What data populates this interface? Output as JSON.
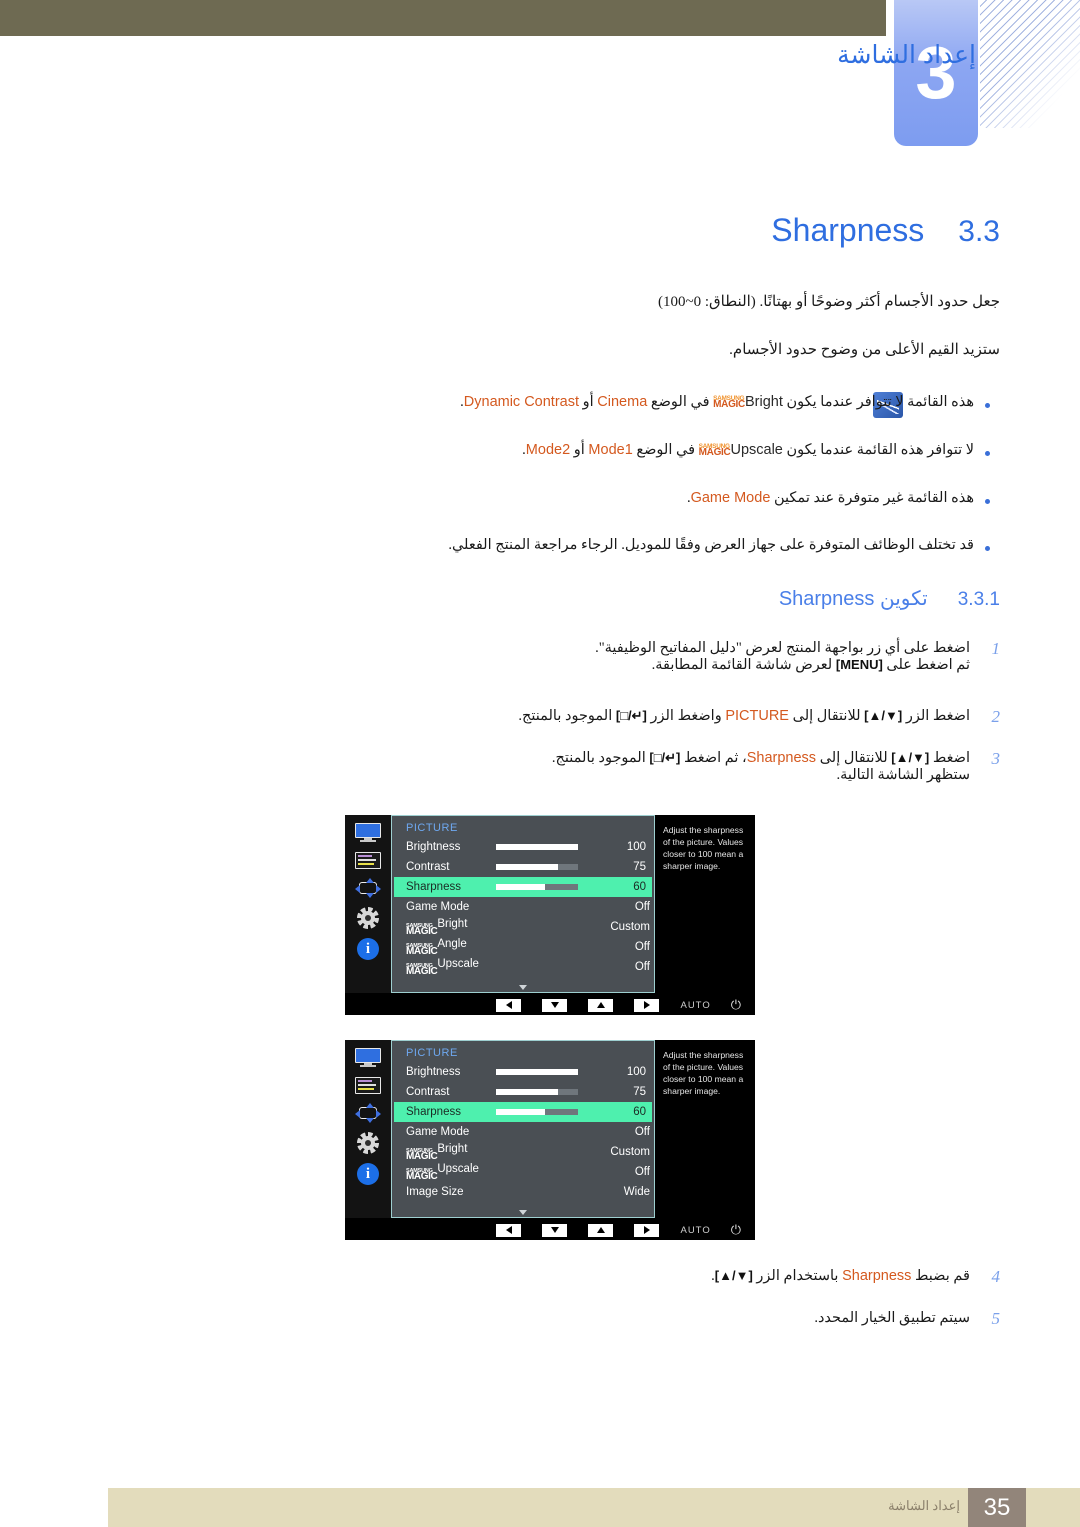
{
  "header": {
    "chapter_number": "3",
    "chapter_title": "إعداد الشاشة"
  },
  "section": {
    "number": "3.3",
    "title": "Sharpness"
  },
  "intro": {
    "line1": "جعل حدود الأجسام أكثر وضوحًا أو بهتانًا. (النطاق: 0~100)",
    "line2": "ستزيد القيم الأعلى من وضوح حدود الأجسام."
  },
  "notes": [
    {
      "pre": "هذه القائمة لا تتوافر عندما يكون ",
      "magic_word": "Bright",
      "mid": " في الوضع ",
      "em1": "Cinema",
      "mid2": " أو ",
      "em2": "Dynamic Contrast",
      "post": "."
    },
    {
      "pre": "لا تتوافر هذه القائمة عندما يكون ",
      "magic_word": "Upscale",
      "mid": " في الوضع ",
      "em1": "Mode1",
      "mid2": " أو ",
      "em2": "Mode2",
      "post": "."
    },
    {
      "pre": "هذه القائمة غير متوفرة عند تمكين ",
      "em1": "Game Mode",
      "post": "."
    },
    {
      "plain": "قد تختلف الوظائف المتوفرة على جهاز العرض وفقًا للموديل. الرجاء مراجعة المنتج الفعلي."
    }
  ],
  "subsection": {
    "number": "3.3.1",
    "title_ar": "تكوين",
    "title_en": "Sharpness"
  },
  "steps": [
    {
      "n": "1",
      "line1": "اضغط على أي زر بواجهة المنتج لعرض \"دليل المفاتيح الوظيفية\".",
      "line2_pre": "ثم اضغط على ",
      "line2_key": "[MENU]",
      "line2_post": " لعرض شاشة القائمة المطابقة."
    },
    {
      "n": "2",
      "pre": "اضغط الزر ",
      "key1": "[▲/▼]",
      "mid": " للانتقال إلى ",
      "em": "PICTURE",
      "mid2": " واضغط الزر ",
      "key2": "[□/↵]",
      "post": " الموجود بالمنتج."
    },
    {
      "n": "3",
      "pre": "اضغط ",
      "key1": "[▲/▼]",
      "mid": " للانتقال إلى ",
      "em": "Sharpness",
      "mid2": "، ثم اضغط ",
      "key2": "[□/↵]",
      "post": " الموجود بالمنتج.",
      "line2": "ستظهر الشاشة التالية."
    },
    {
      "n": "4",
      "pre": "قم بضبط ",
      "em": "Sharpness",
      "mid": " باستخدام الزر ",
      "key1": "[▲/▼]",
      "post": "."
    },
    {
      "n": "5",
      "plain": "سيتم تطبيق الخيار المحدد."
    }
  ],
  "osd": {
    "heading": "PICTURE",
    "help_text": "Adjust the sharpness of the picture. Values closer to 100 mean a sharper image.",
    "bottom": {
      "auto_label": "AUTO",
      "power_icon": "⏻",
      "left_icon": "left-arrow",
      "down_icon": "down-arrow",
      "up_icon": "up-arrow",
      "right_icon": "right-arrow"
    },
    "rail_icons": [
      "monitor-icon",
      "color-list-icon",
      "position-arrows-icon",
      "gear-icon",
      "info-icon"
    ],
    "menu1": [
      {
        "label": "Brightness",
        "value": "100",
        "bar": 100,
        "selected": false
      },
      {
        "label": "Contrast",
        "value": "75",
        "bar": 75,
        "selected": false
      },
      {
        "label": "Sharpness",
        "value": "60",
        "bar": 60,
        "selected": true
      },
      {
        "label": "Game Mode",
        "value": "Off",
        "bar": null,
        "selected": false
      },
      {
        "magic": "Bright",
        "label": "",
        "value": "Custom",
        "bar": null,
        "selected": false
      },
      {
        "magic": "Angle",
        "label": "",
        "value": "Off",
        "bar": null,
        "selected": false
      },
      {
        "magic": "Upscale",
        "label": "",
        "value": "Off",
        "bar": null,
        "selected": false
      }
    ],
    "menu2": [
      {
        "label": "Brightness",
        "value": "100",
        "bar": 100,
        "selected": false
      },
      {
        "label": "Contrast",
        "value": "75",
        "bar": 75,
        "selected": false
      },
      {
        "label": "Sharpness",
        "value": "60",
        "bar": 60,
        "selected": true
      },
      {
        "label": "Game Mode",
        "value": "Off",
        "bar": null,
        "selected": false
      },
      {
        "magic": "Bright",
        "label": "",
        "value": "Custom",
        "bar": null,
        "selected": false
      },
      {
        "magic": "Upscale",
        "label": "",
        "value": "Off",
        "bar": null,
        "selected": false
      },
      {
        "label": "Image Size",
        "value": "Wide",
        "bar": null,
        "selected": false
      }
    ],
    "magic_brand": {
      "top": "SAMSUNG",
      "bottom": "MAGIC"
    }
  },
  "magic_brand": {
    "top": "SAMSUNG",
    "bottom": "MAGIC"
  },
  "footer": {
    "label": "إعداد الشاشة",
    "page": "35"
  },
  "colors": {
    "accent_blue": "#2f6ee0",
    "orange": "#d4591f",
    "olive": "#6e6a52",
    "beige": "#e3dcbc",
    "osd_select": "#4ef0ae"
  }
}
